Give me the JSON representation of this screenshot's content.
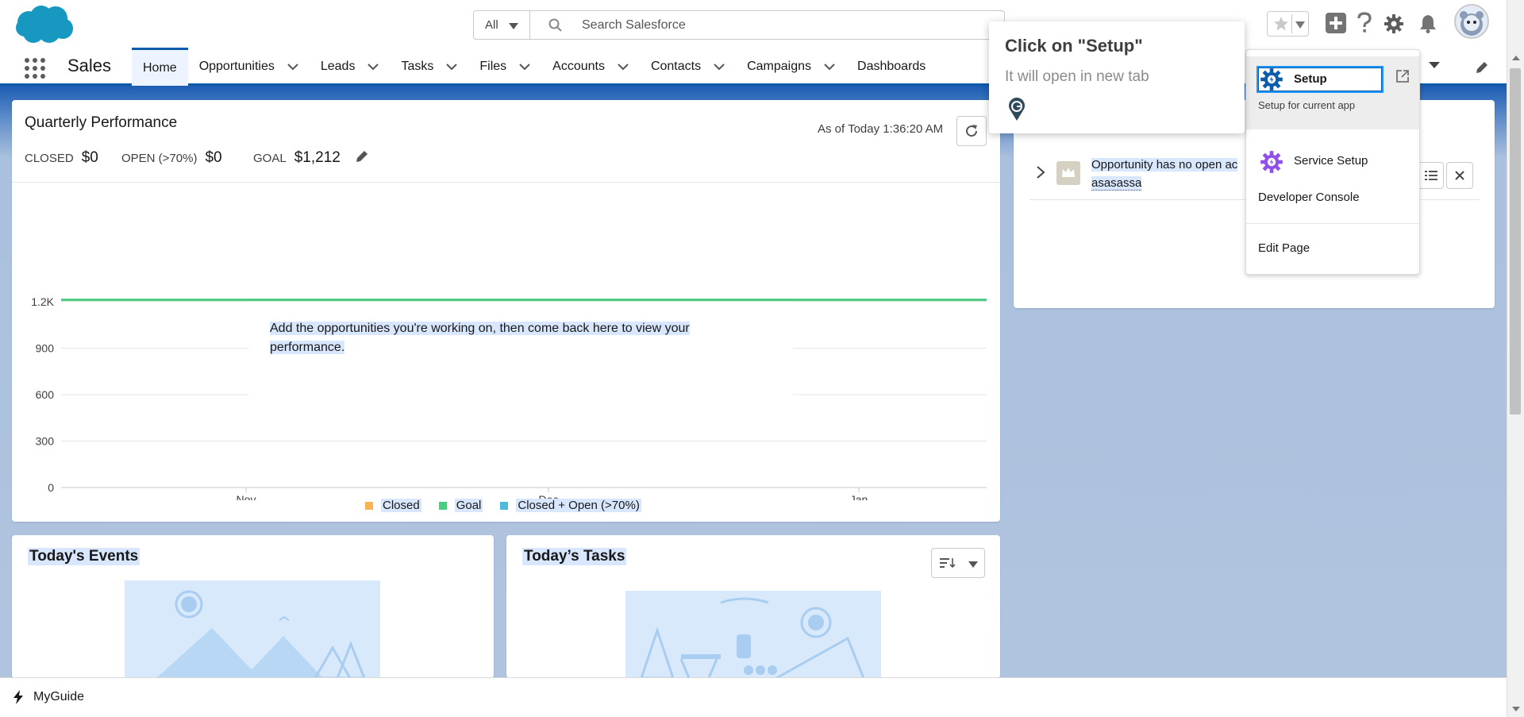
{
  "header": {
    "search_scope": "All",
    "search_placeholder": "Search Salesforce"
  },
  "nav": {
    "app_name": "Sales",
    "tabs": [
      {
        "label": "Home",
        "active": true,
        "has_dropdown": false
      },
      {
        "label": "Opportunities",
        "has_dropdown": true
      },
      {
        "label": "Leads",
        "has_dropdown": true
      },
      {
        "label": "Tasks",
        "has_dropdown": true
      },
      {
        "label": "Files",
        "has_dropdown": true
      },
      {
        "label": "Accounts",
        "has_dropdown": true
      },
      {
        "label": "Contacts",
        "has_dropdown": true
      },
      {
        "label": "Campaigns",
        "has_dropdown": true
      },
      {
        "label": "Dashboards",
        "has_dropdown": false
      }
    ]
  },
  "quarterly": {
    "title": "Quarterly Performance",
    "as_of": "As of Today 1:36:20 AM",
    "closed_label": "CLOSED",
    "closed_value": "$0",
    "open_label": "OPEN (>70%)",
    "open_value": "$0",
    "goal_label": "GOAL",
    "goal_value": "$1,212",
    "empty_message": "Add the opportunities you're working on, then come back here to view your performance."
  },
  "chart_data": {
    "type": "line",
    "x_ticks": [
      "Nov",
      "Dec",
      "Jan"
    ],
    "y_ticks": [
      "0",
      "300",
      "600",
      "900",
      "1.2K"
    ],
    "ylim": [
      0,
      1200
    ],
    "series": [
      {
        "name": "Closed",
        "color": "#f9b356",
        "values": []
      },
      {
        "name": "Goal",
        "color": "#4bca81",
        "values": [
          1212,
          1212
        ]
      },
      {
        "name": "Closed + Open (>70%)",
        "color": "#4fb8dd",
        "values": []
      }
    ],
    "legend_position": "bottom"
  },
  "events": {
    "title": "Today's Events"
  },
  "tasks": {
    "title": "Today’s Tasks"
  },
  "assistant": {
    "message": "Opportunity has no open ac",
    "record": "asasassa"
  },
  "setup_menu": {
    "items": [
      {
        "label": "Setup",
        "sub": "Setup for current app"
      },
      {
        "label": "Service Setup"
      },
      {
        "label": "Developer Console"
      },
      {
        "label": "Edit Page"
      }
    ]
  },
  "guide_tip": {
    "title": "Click on \"Setup\"",
    "subtitle": "It will open in new tab"
  },
  "utility_bar": {
    "label": "MyGuide"
  },
  "colors": {
    "brand_blue": "#0b5cab",
    "cloud_blue": "#1798c1",
    "highlight": "#d8e6fe",
    "goal_green": "#4bca81"
  }
}
